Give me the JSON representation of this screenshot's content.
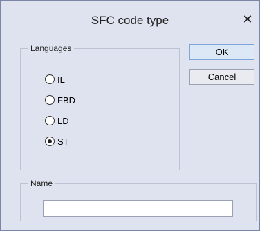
{
  "dialog": {
    "title": "SFC code type",
    "close_glyph": "✕"
  },
  "languages": {
    "legend": "Languages",
    "options": [
      {
        "label": "IL",
        "selected": false
      },
      {
        "label": "FBD",
        "selected": false
      },
      {
        "label": "LD",
        "selected": false
      },
      {
        "label": "ST",
        "selected": true
      }
    ]
  },
  "buttons": {
    "ok": "OK",
    "cancel": "Cancel"
  },
  "name": {
    "legend": "Name",
    "value": "",
    "placeholder": ""
  }
}
